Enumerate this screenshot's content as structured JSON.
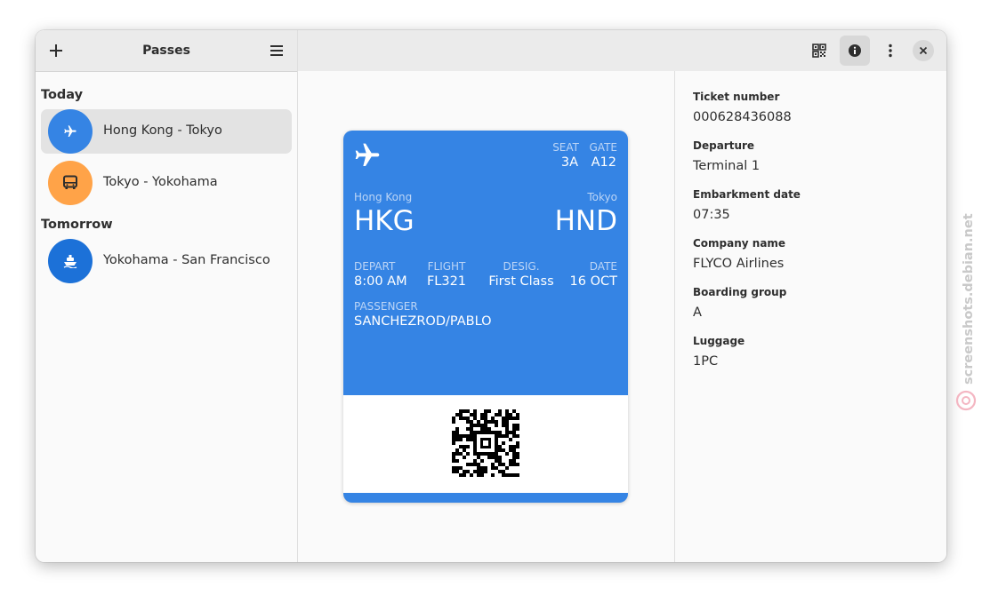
{
  "sidebar": {
    "title": "Passes",
    "groups": [
      {
        "title": "Today",
        "items": [
          {
            "label": "Hong Kong - Tokyo",
            "icon": "airplane-icon",
            "color": "#3584e4",
            "selected": true
          },
          {
            "label": "Tokyo - Yokohama",
            "icon": "bus-icon",
            "color": "#ffa348",
            "selected": false
          }
        ]
      },
      {
        "title": "Tomorrow",
        "items": [
          {
            "label": "Yokohama - San Francisco",
            "icon": "ship-icon",
            "color": "#1c71d8",
            "selected": false
          }
        ]
      }
    ]
  },
  "pass": {
    "seat_label": "SEAT",
    "seat": "3A",
    "gate_label": "GATE",
    "gate": "A12",
    "origin_city": "Hong Kong",
    "origin_code": "HKG",
    "dest_city": "Tokyo",
    "dest_code": "HND",
    "depart_label": "DEPART",
    "depart": "8:00 AM",
    "flight_label": "FLIGHT",
    "flight": "FL321",
    "desig_label": "DESIG.",
    "desig": "First Class",
    "date_label": "DATE",
    "date": "16 OCT",
    "passenger_label": "PASSENGER",
    "passenger": "SANCHEZROD/PABLO",
    "color": "#3584e4"
  },
  "details": [
    {
      "label": "Ticket number",
      "value": "000628436088"
    },
    {
      "label": "Departure",
      "value": "Terminal 1"
    },
    {
      "label": "Embarkment date",
      "value": "07:35"
    },
    {
      "label": "Company name",
      "value": "FLYCO Airlines"
    },
    {
      "label": "Boarding group",
      "value": "A"
    },
    {
      "label": "Luggage",
      "value": "1PC"
    }
  ],
  "watermark": "screenshots.debian.net"
}
